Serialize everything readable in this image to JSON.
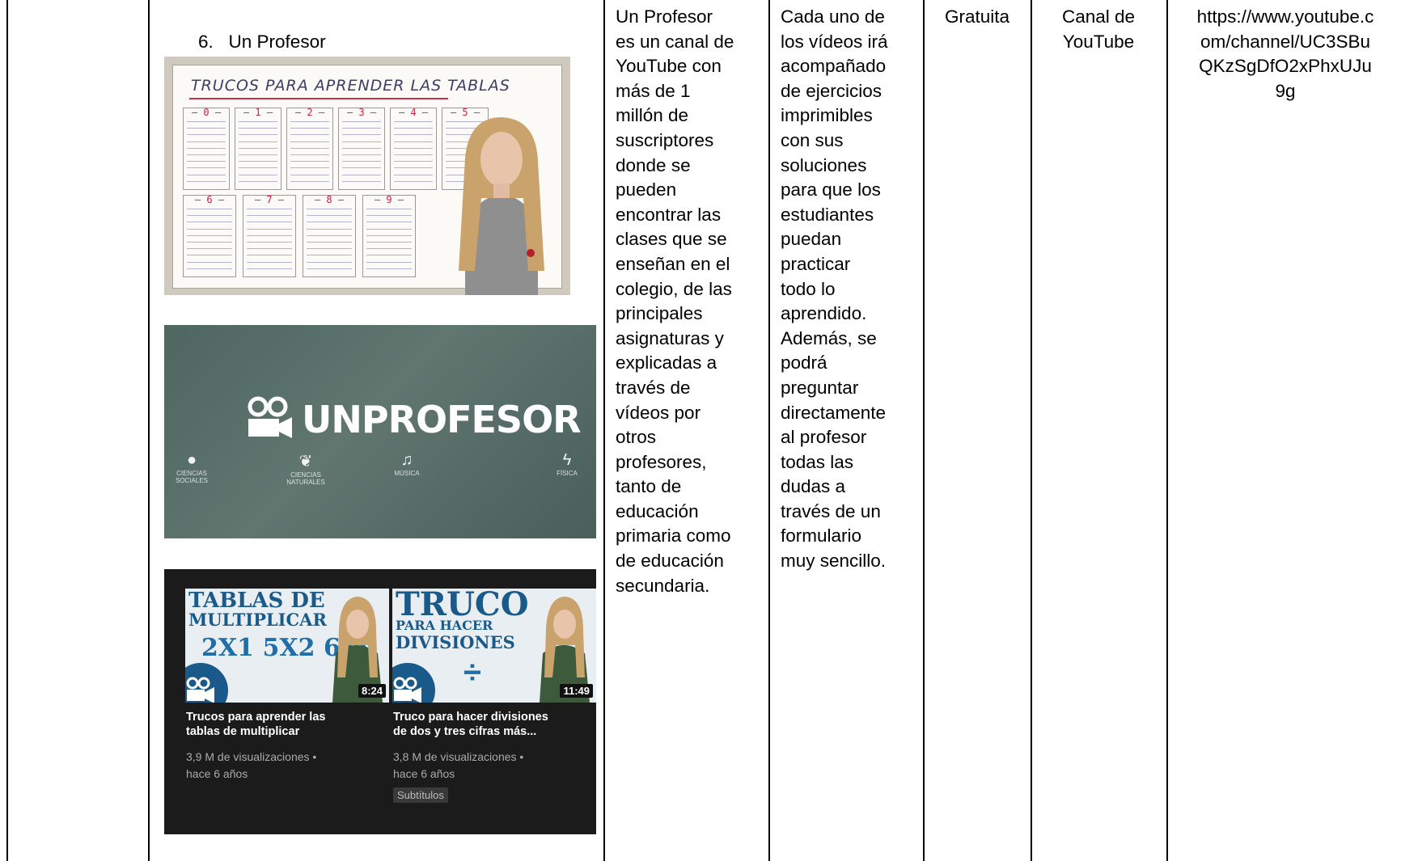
{
  "row": {
    "item_number": "6.",
    "item_name": "Un Profesor",
    "description": "Un Profesor\nes un canal de\nYouTube con\nmás de 1\nmillón de\nsuscriptores\ndonde se\npueden\nencontrar las\nclases que se\nenseñan en el\ncolegio, de las\nprincipales\nasignaturas y\nexplicadas a\ntravés de\nvídeos por\notros\nprofesores,\ntanto de\neducación\nprimaria como\nde educación\nsecundaria.",
    "features": "Cada uno de\nlos vídeos irá\nacompañado\nde ejercicios\nimprimibles\ncon sus\nsoluciones\npara que los\nestudiantes\npuedan\npracticar\ntodo lo\naprendido.\nAdemás, se\npodrá\npreguntar\ndirectamente\nal profesor\ntodas las\ndudas a\ntravés de un\nformulario\nmuy sencillo.",
    "price": "Gratuita",
    "type": "Canal de\nYouTube",
    "url": "https://www.youtube.c\nom/channel/UC3SBu\nQKzSgDfO2xPhxUJu\n9g"
  },
  "board_image": {
    "title": "TRUCOS PARA APRENDER LAS TABLAS",
    "top_numbers": [
      "0",
      "1",
      "2",
      "3",
      "4",
      "5"
    ],
    "bottom_numbers": [
      "6",
      "7",
      "8",
      "9"
    ]
  },
  "banner_image": {
    "logo_text": "UNPROFESOR",
    "subjects": [
      {
        "icon": "globe-icon",
        "label": "CIENCIAS SOCIALES"
      },
      {
        "icon": "leaf-icon",
        "label": "CIENCIAS NATURALES"
      },
      {
        "icon": "music-note-icon",
        "label": "MÚSICA"
      },
      {
        "icon": "lightning-icon",
        "label": "FÍSICA"
      }
    ]
  },
  "videos": [
    {
      "thumb_line1": "TABLAS DE",
      "thumb_line2": "MULTIPLICAR",
      "thumb_line3": "2X1  5X2  6X9",
      "duration": "8:24",
      "title": "Trucos para aprender las\ntablas de multiplicar",
      "meta": "3,9 M de visualizaciones •\nhace 6 años"
    },
    {
      "thumb_line1": "TRUCO",
      "thumb_line2": "PARA HACER",
      "thumb_line3": "DIVISIONES",
      "duration": "11:49",
      "title": "Truco para hacer divisiones\nde dos y tres cifras más...",
      "meta": "3,8 M de visualizaciones •\nhace 6 años",
      "badge": "Subtítulos"
    }
  ],
  "colors": {
    "border": "#000000",
    "banner_bg": "#55696a",
    "yt_bg": "#1b1b1b",
    "thumb_title": "#1a5a8a"
  }
}
